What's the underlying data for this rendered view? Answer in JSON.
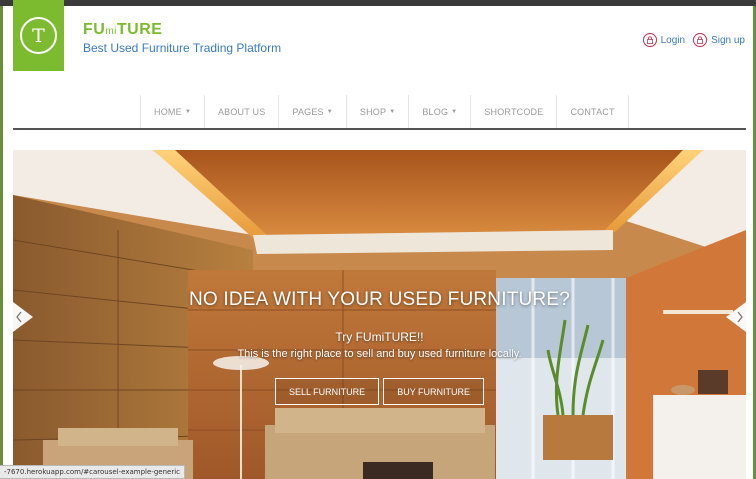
{
  "brand": {
    "logo_letter": "T",
    "name_part1": "FU",
    "name_part2": "mi",
    "name_part3": "TURE",
    "tagline": "Best Used Furniture Trading Platform",
    "color": "#7cbb2f"
  },
  "auth": {
    "login_label": "Login",
    "signup_label": "Sign up",
    "icon_color": "#c0314e"
  },
  "nav": {
    "items": [
      {
        "label": "HOME",
        "dropdown": true
      },
      {
        "label": "ABOUT US",
        "dropdown": false
      },
      {
        "label": "PAGES",
        "dropdown": true
      },
      {
        "label": "SHOP",
        "dropdown": true
      },
      {
        "label": "BLOG",
        "dropdown": true
      },
      {
        "label": "SHORTCODE",
        "dropdown": false
      },
      {
        "label": "CONTACT",
        "dropdown": false
      }
    ]
  },
  "carousel": {
    "headline": "NO IDEA WITH YOUR USED FURNITURE?",
    "subtitle": "Try FUmiTURE!!",
    "subtext": "This is the right place to sell and buy used furniture locally.",
    "sell_button": "SELL FURNITURE",
    "buy_button": "BUY FURNITURE"
  },
  "statusbar": {
    "url": "-7670.herokuapp.com/#carousel-example-generic"
  }
}
